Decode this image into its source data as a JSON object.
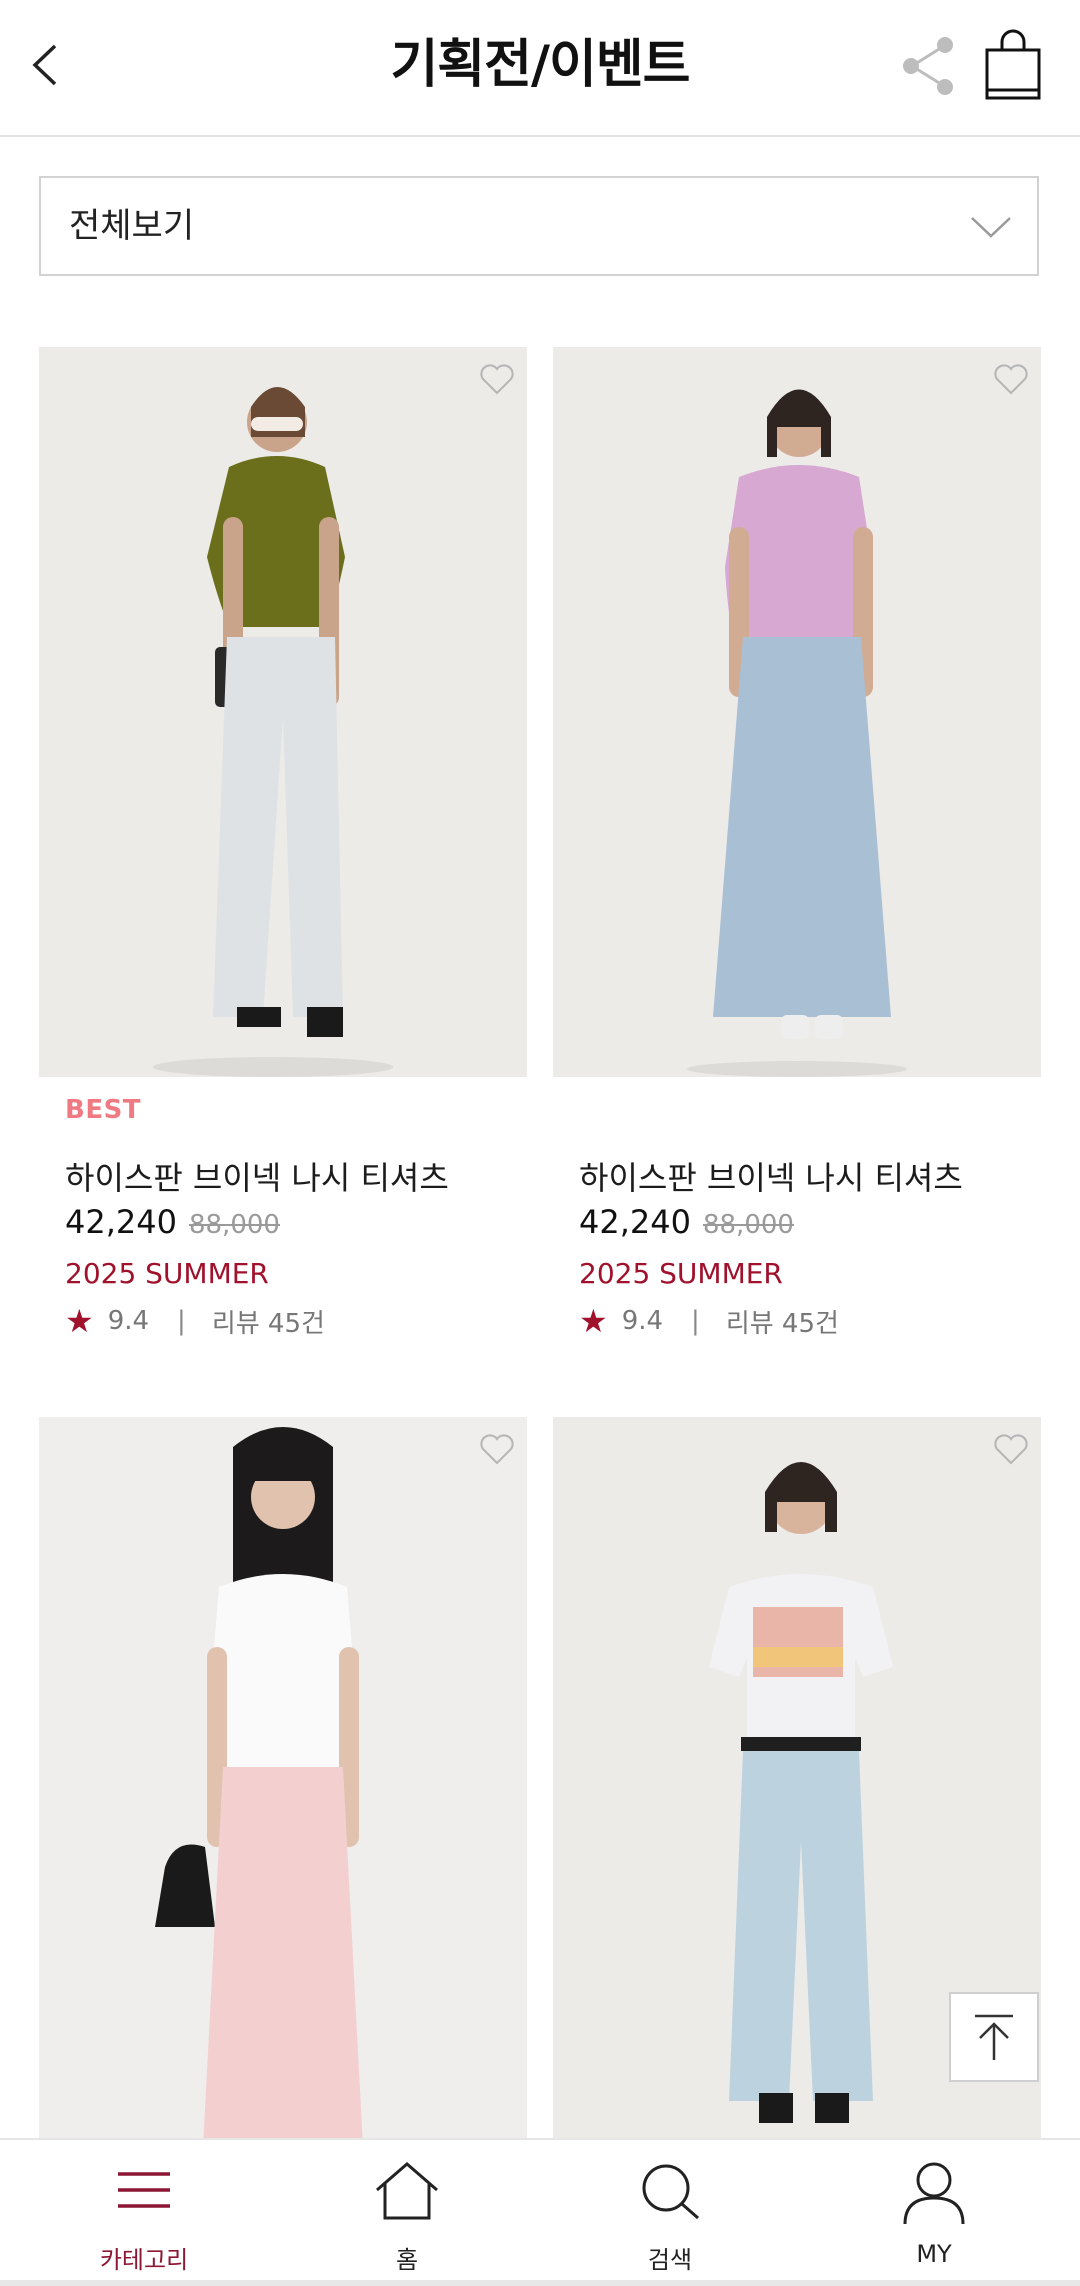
{
  "header": {
    "title": "기획전/이벤트",
    "back_icon": "chevron-left-icon",
    "share_icon": "share-icon",
    "bag_icon": "shopping-bag-icon"
  },
  "filter": {
    "selected": "전체보기"
  },
  "products": [
    {
      "badge": "BEST",
      "name": "하이스판 브이넥 나시 티셔츠",
      "price": "42,240",
      "original_price": "88,000",
      "season": "2025 SUMMER",
      "rating": "9.4",
      "reviews": "리뷰 45건",
      "top_color": "#6b6f1c",
      "bottom_color": "#dfe2e4"
    },
    {
      "badge": "",
      "name": "하이스판 브이넥 나시 티셔츠",
      "price": "42,240",
      "original_price": "88,000",
      "season": "2025 SUMMER",
      "rating": "9.4",
      "reviews": "리뷰 45건",
      "top_color": "#d6a8d2",
      "bottom_color": "#a8bfd4"
    },
    {
      "badge": "",
      "name": "",
      "price": "",
      "original_price": "",
      "season": "",
      "rating": "",
      "reviews": "",
      "top_color": "#fafafa",
      "bottom_color": "#f4cfd0"
    },
    {
      "badge": "",
      "name": "",
      "price": "",
      "original_price": "",
      "season": "",
      "rating": "",
      "reviews": "",
      "top_color": "#f2f2f4",
      "bottom_color": "#bcd3df"
    }
  ],
  "bottom_nav": {
    "items": [
      {
        "label": "카테고리",
        "icon": "menu-icon",
        "active": true
      },
      {
        "label": "홈",
        "icon": "home-icon",
        "active": false
      },
      {
        "label": "검색",
        "icon": "search-icon",
        "active": false
      },
      {
        "label": "MY",
        "icon": "user-icon",
        "active": false
      }
    ]
  },
  "colors": {
    "accent": "#a0112c",
    "badge": "#f07a82",
    "nav_active": "#8b1733"
  }
}
